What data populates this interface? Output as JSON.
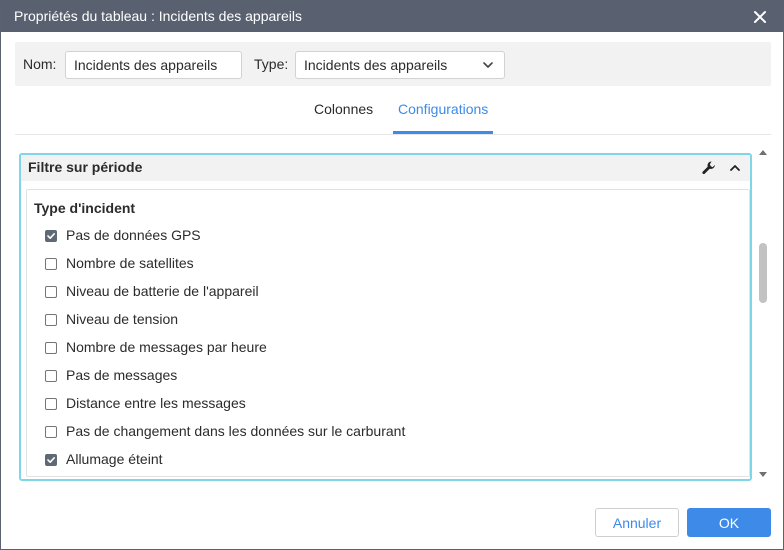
{
  "dialog": {
    "title": "Propriétés du tableau : Incidents des appareils"
  },
  "header": {
    "name_label": "Nom:",
    "name_value": "Incidents des appareils",
    "type_label": "Type:",
    "type_value": "Incidents des appareils"
  },
  "tabs": [
    {
      "label": "Colonnes",
      "active": false
    },
    {
      "label": "Configurations",
      "active": true
    }
  ],
  "section": {
    "title": "Filtre sur période",
    "group_title": "Type d'incident",
    "options": [
      {
        "label": "Pas de données GPS",
        "checked": true
      },
      {
        "label": "Nombre de satellites",
        "checked": false
      },
      {
        "label": "Niveau de batterie de l'appareil",
        "checked": false
      },
      {
        "label": "Niveau de tension",
        "checked": false
      },
      {
        "label": "Nombre de messages par heure",
        "checked": false
      },
      {
        "label": "Pas de messages",
        "checked": false
      },
      {
        "label": "Distance entre les messages",
        "checked": false
      },
      {
        "label": "Pas de changement dans les données sur le carburant",
        "checked": false
      },
      {
        "label": "Allumage éteint",
        "checked": true
      }
    ]
  },
  "footer": {
    "cancel_label": "Annuler",
    "ok_label": "OK"
  },
  "colors": {
    "titlebar": "#596170",
    "accent": "#3d8ae8",
    "section_border": "#7fd6e6"
  }
}
